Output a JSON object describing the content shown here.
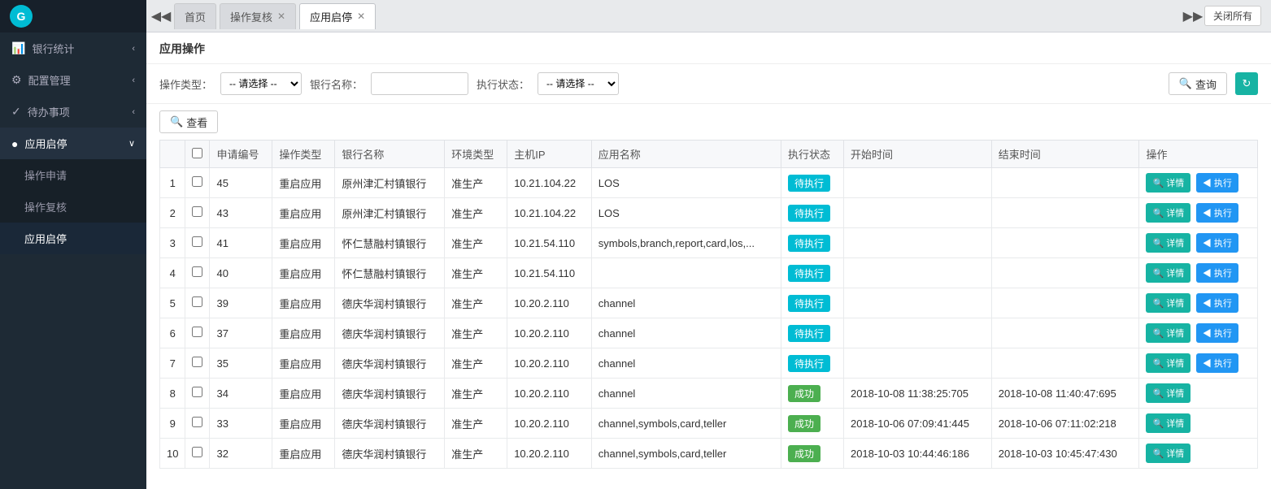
{
  "sidebar": {
    "logo_text": "G",
    "items": [
      {
        "id": "bank-stats",
        "label": "银行统计",
        "icon": "📊",
        "active": false,
        "has_arrow": true
      },
      {
        "id": "config-mgmt",
        "label": "配置管理",
        "icon": "⚙",
        "active": false,
        "has_arrow": true
      },
      {
        "id": "todo",
        "label": "待办事项",
        "icon": "✓",
        "active": false,
        "has_arrow": true
      },
      {
        "id": "app-start",
        "label": "应用启停",
        "icon": "●",
        "active": true,
        "has_arrow": true
      }
    ],
    "sub_items": [
      {
        "id": "op-apply",
        "label": "操作申请",
        "active": false
      },
      {
        "id": "op-review",
        "label": "操作复核",
        "active": false
      },
      {
        "id": "app-stop",
        "label": "应用启停",
        "active": true
      }
    ]
  },
  "tabs": {
    "nav_prev": "◀◀",
    "nav_next": "▶▶",
    "close_all": "关闭所有",
    "items": [
      {
        "id": "home",
        "label": "首页",
        "closable": false,
        "active": false
      },
      {
        "id": "op-review",
        "label": "操作复核",
        "closable": true,
        "active": false
      },
      {
        "id": "app-stop",
        "label": "应用启停",
        "closable": true,
        "active": true
      }
    ]
  },
  "page": {
    "title": "应用操作",
    "filter": {
      "op_type_label": "操作类型：",
      "op_type_placeholder": "-- 请选择 --",
      "bank_name_label": "银行名称：",
      "bank_name_placeholder": "",
      "exec_status_label": "执行状态：",
      "exec_status_placeholder": "-- 请选择 --",
      "query_btn": "查询",
      "view_btn": "查看"
    },
    "table": {
      "columns": [
        "",
        "申请编号",
        "操作类型",
        "银行名称",
        "环境类型",
        "主机IP",
        "应用名称",
        "执行状态",
        "开始时间",
        "结束时间",
        "操作"
      ],
      "rows": [
        {
          "num": 1,
          "id": "45",
          "op_type": "重启应用",
          "bank": "原州津汇村镇银行",
          "env": "准生产",
          "ip": "10.21.104.22",
          "app": "LOS",
          "status": "待执行",
          "start": "",
          "end": "",
          "has_exec": true
        },
        {
          "num": 2,
          "id": "43",
          "op_type": "重启应用",
          "bank": "原州津汇村镇银行",
          "env": "准生产",
          "ip": "10.21.104.22",
          "app": "LOS",
          "status": "待执行",
          "start": "",
          "end": "",
          "has_exec": true
        },
        {
          "num": 3,
          "id": "41",
          "op_type": "重启应用",
          "bank": "怀仁慧融村镇银行",
          "env": "准生产",
          "ip": "10.21.54.110",
          "app": "symbols,branch,report,card,los,...",
          "status": "待执行",
          "start": "",
          "end": "",
          "has_exec": true
        },
        {
          "num": 4,
          "id": "40",
          "op_type": "重启应用",
          "bank": "怀仁慧融村镇银行",
          "env": "准生产",
          "ip": "10.21.54.110",
          "app": "",
          "status": "待执行",
          "start": "",
          "end": "",
          "has_exec": true
        },
        {
          "num": 5,
          "id": "39",
          "op_type": "重启应用",
          "bank": "德庆华润村镇银行",
          "env": "准生产",
          "ip": "10.20.2.110",
          "app": "channel",
          "status": "待执行",
          "start": "",
          "end": "",
          "has_exec": true
        },
        {
          "num": 6,
          "id": "37",
          "op_type": "重启应用",
          "bank": "德庆华润村镇银行",
          "env": "准生产",
          "ip": "10.20.2.110",
          "app": "channel",
          "status": "待执行",
          "start": "",
          "end": "",
          "has_exec": true
        },
        {
          "num": 7,
          "id": "35",
          "op_type": "重启应用",
          "bank": "德庆华润村镇银行",
          "env": "准生产",
          "ip": "10.20.2.110",
          "app": "channel",
          "status": "待执行",
          "start": "",
          "end": "",
          "has_exec": true
        },
        {
          "num": 8,
          "id": "34",
          "op_type": "重启应用",
          "bank": "德庆华润村镇银行",
          "env": "准生产",
          "ip": "10.20.2.110",
          "app": "channel",
          "status": "成功",
          "start": "2018-10-08 11:38:25:705",
          "end": "2018-10-08 11:40:47:695",
          "has_exec": false
        },
        {
          "num": 9,
          "id": "33",
          "op_type": "重启应用",
          "bank": "德庆华润村镇银行",
          "env": "准生产",
          "ip": "10.20.2.110",
          "app": "channel,symbols,card,teller",
          "status": "成功",
          "start": "2018-10-06 07:09:41:445",
          "end": "2018-10-06 07:11:02:218",
          "has_exec": false
        },
        {
          "num": 10,
          "id": "32",
          "op_type": "重启应用",
          "bank": "德庆华润村镇银行",
          "env": "准生产",
          "ip": "10.20.2.110",
          "app": "channel,symbols,card,teller",
          "status": "成功",
          "start": "2018-10-03 10:44:46:186",
          "end": "2018-10-03 10:45:47:430",
          "has_exec": false
        }
      ],
      "btn_detail": "详情",
      "btn_exec": "执行"
    }
  },
  "colors": {
    "sidebar_bg": "#1e2a35",
    "accent": "#17b3a3",
    "pending": "#00bcd4",
    "success": "#4caf50",
    "exec_btn": "#2196f3"
  }
}
